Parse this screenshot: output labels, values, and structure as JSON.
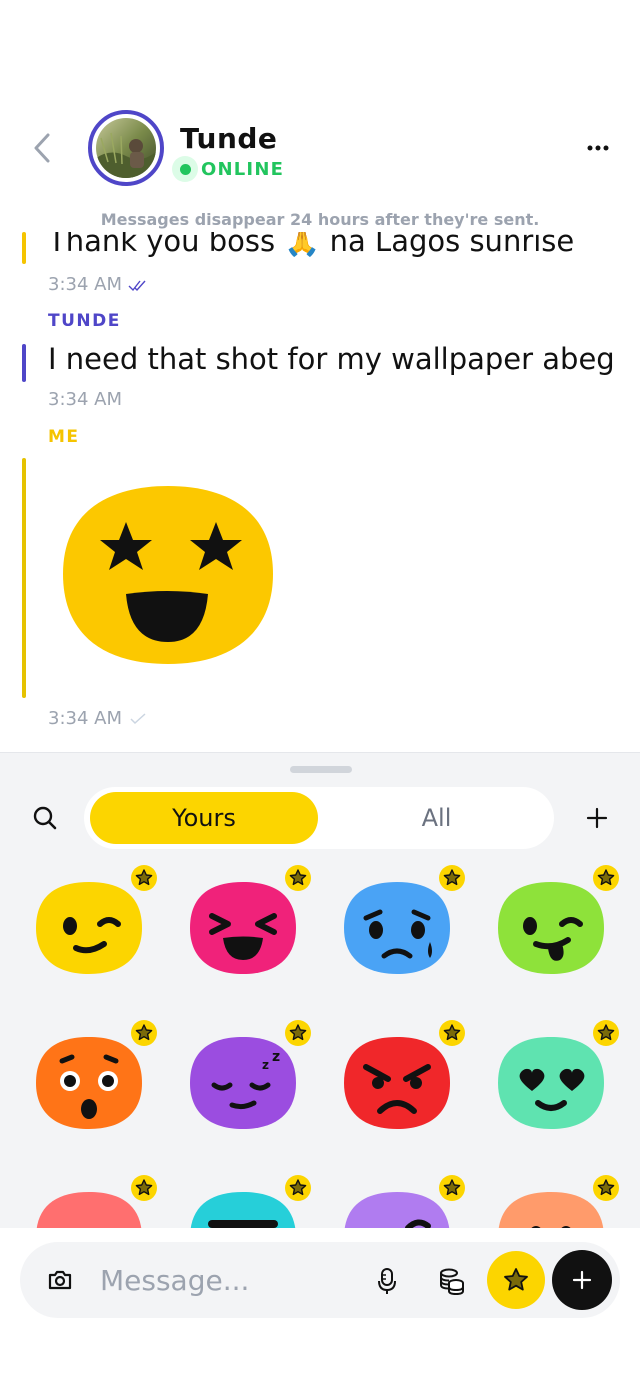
{
  "header": {
    "contact_name": "Tunde",
    "status": "ONLINE",
    "back_icon": "chevron-left-icon",
    "more_icon": "more-horizontal-icon"
  },
  "disappear_notice": "Messages disappear 24 hours after they're sent.",
  "messages": [
    {
      "text": "Thank you boss 🙏 na Lagos sunrise",
      "time": "3:34 AM",
      "ticks": "read",
      "accent": "#f5c400"
    },
    {
      "sender": "TUNDE",
      "text": "I need that shot for my wallpaper abeg",
      "time": "3:34 AM",
      "accent": "#4f46c8"
    },
    {
      "sender": "ME",
      "sticker": "star-eyes-face",
      "time": "3:34 AM",
      "ticks": "sent",
      "accent": "#f5c400"
    }
  ],
  "sticker_panel": {
    "tabs": [
      "Yours",
      "All"
    ],
    "active_tab": "Yours",
    "stickers": [
      {
        "name": "wink",
        "color": "#fcd500"
      },
      {
        "name": "laughing",
        "color": "#f0227a"
      },
      {
        "name": "crying",
        "color": "#4aa3f5"
      },
      {
        "name": "tongue-wink",
        "color": "#8ee23a"
      },
      {
        "name": "surprised",
        "color": "#ff7417"
      },
      {
        "name": "sleepy",
        "color": "#9b4de0"
      },
      {
        "name": "angry",
        "color": "#f0272a"
      },
      {
        "name": "heart-eyes",
        "color": "#5fe3b0"
      },
      {
        "name": "partial-coral",
        "color": "#ff6f6f"
      },
      {
        "name": "partial-cyan",
        "color": "#26cfd9"
      },
      {
        "name": "partial-lavender",
        "color": "#b07cf0"
      },
      {
        "name": "partial-peach",
        "color": "#ff9b6b"
      }
    ]
  },
  "composer": {
    "placeholder": "Message...",
    "icons": [
      "camera-icon",
      "microphone-icon",
      "coins-icon",
      "sticker-star-icon",
      "plus-icon"
    ]
  },
  "colors": {
    "accent_yellow": "#fcd500",
    "accent_purple": "#4f46c8",
    "online_green": "#22c55e"
  }
}
